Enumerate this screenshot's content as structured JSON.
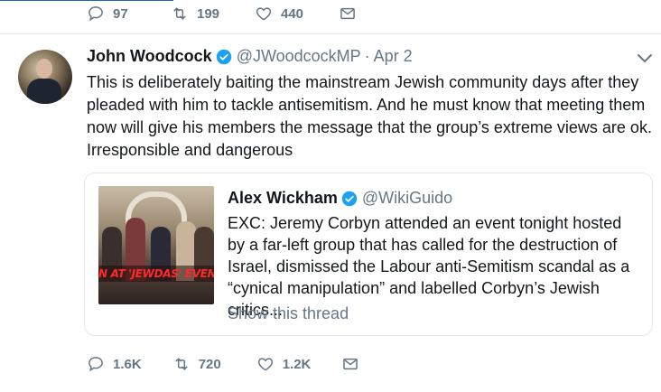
{
  "prev_tweet": {
    "actions": {
      "replies": "97",
      "retweets": "199",
      "likes": "440"
    }
  },
  "tweet": {
    "author_name": "John Woodcock",
    "handle": "@JWoodcockMP",
    "separator": "·",
    "date": "Apr 2",
    "text": "This is deliberately baiting the mainstream Jewish community days after they pleaded with him to tackle antisemitism. And he must know that meeting them now will give his members the message that the group’s extreme views are ok. Irresponsible and dangerous",
    "actions": {
      "replies": "1.6K",
      "retweets": "720",
      "likes": "1.2K"
    }
  },
  "quoted_tweet": {
    "author_name": "Alex Wickham",
    "handle": "@WikiGuido",
    "media_banner": "N AT 'JEWDAS' EVENT TO",
    "text": "EXC: Jeremy Corbyn attended an event tonight hosted by a far-left group that has called for the destruction of Israel, dismissed the Labour anti-Semitism scandal as a “cynical manipulation” and labelled Corbyn’s Jewish critics...",
    "show_thread": "Show this thread"
  },
  "colors": {
    "verified": "#1da1f2",
    "muted": "#657786",
    "text": "#14171a",
    "border": "#e1e8ed"
  }
}
